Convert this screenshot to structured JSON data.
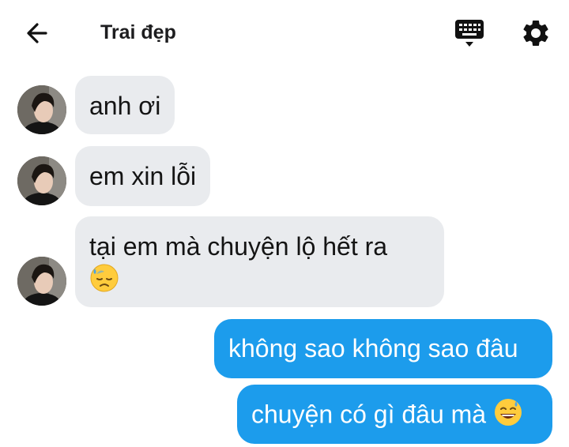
{
  "header": {
    "title": "Trai đẹp",
    "back_icon": "arrow-left-icon",
    "keyboard_icon": "keyboard-icon",
    "settings_icon": "gear-icon"
  },
  "colors": {
    "incoming_bubble": "#e9ebee",
    "outgoing_bubble": "#1c9cec",
    "text": "#141414"
  },
  "messages": [
    {
      "direction": "incoming",
      "text": "anh ơi"
    },
    {
      "direction": "incoming",
      "text": "em xin lỗi"
    },
    {
      "direction": "incoming",
      "text": "tại em mà chuyện lộ hết ra",
      "emoji": "downcast-face-with-sweat-emoji"
    },
    {
      "direction": "outgoing",
      "text": "không sao không sao đâu"
    },
    {
      "direction": "outgoing",
      "text": "chuyện có gì đâu mà",
      "emoji": "grinning-face-with-sweat-emoji"
    }
  ]
}
